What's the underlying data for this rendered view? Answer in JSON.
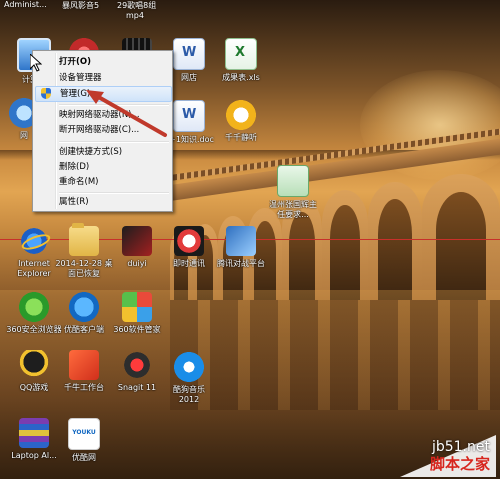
{
  "top_row": [
    "Administ...",
    "暴风影音5",
    "29歌唱8组",
    "mp4"
  ],
  "context_menu": {
    "items": [
      {
        "label": "打开(O)",
        "bold": true
      },
      {
        "label": "设备管理器"
      },
      {
        "label": "管理(G)",
        "highlighted": true,
        "icon": "uac-shield-icon"
      },
      {
        "label": "映射网络驱动器(N)..."
      },
      {
        "label": "断开网络驱动器(C)..."
      },
      {
        "label": "创建快捷方式(S)"
      },
      {
        "label": "删除(D)"
      },
      {
        "label": "重命名(M)"
      },
      {
        "label": "属性(R)"
      }
    ]
  },
  "icons": {
    "computer": {
      "label": "计算机",
      "icon": "computer-icon"
    },
    "network": {
      "label": "网",
      "icon": "network-icon"
    },
    "ie": {
      "label": "Internet Explorer",
      "icon": "internet-explorer-icon"
    },
    "folder_backup": {
      "label": "2014-12-28 桌面已恢复",
      "icon": "folder-icon"
    },
    "duiyi": {
      "label": "duiyi",
      "icon": "game-icon"
    },
    "im": {
      "label": "即时通讯",
      "icon": "instant-messaging-icon"
    },
    "tencent_game": {
      "label": "腾讯对战平台",
      "icon": "tencent-platform-icon"
    },
    "safe360": {
      "label": "360安全浏览器",
      "icon": "360-browser-icon"
    },
    "youku_client": {
      "label": "优酷客户端",
      "icon": "youku-client-icon"
    },
    "mgr360": {
      "label": "360软件管家",
      "icon": "360-software-manager-icon"
    },
    "qq_game": {
      "label": "QQ游戏",
      "icon": "qq-game-icon"
    },
    "qianniu": {
      "label": "千牛工作台",
      "icon": "qianniu-icon"
    },
    "snagit": {
      "label": "Snagit 11",
      "icon": "snagit-icon"
    },
    "kugou": {
      "label": "酷狗音乐2012",
      "icon": "kugou-icon"
    },
    "winrar": {
      "label": "Laptop Al...",
      "icon": "winrar-icon"
    },
    "youku": {
      "label": "优酷网",
      "icon": "youku-icon"
    },
    "doc1": {
      "label": "网店",
      "icon": "word-document-icon"
    },
    "xls1": {
      "label": "成果表.xls",
      "icon": "excel-document-icon"
    },
    "doc2": {
      "label": "S+1知识.doc",
      "icon": "word-document-icon"
    },
    "chat": {
      "label": "千千静听",
      "icon": "chat-icon"
    },
    "red_app": {
      "label": "",
      "icon": "red-app-icon"
    },
    "film": {
      "label": "",
      "icon": "film-icon"
    },
    "doc_green": {
      "label": "温州张国辉主任要求...",
      "icon": "document-icon"
    }
  },
  "watermark": {
    "site": "jb51.net",
    "name": "脚本之家"
  },
  "colors": {
    "guide_line": "#c8302a",
    "arrow": "#c0392b",
    "menu_highlight": "#cfe3f9"
  }
}
